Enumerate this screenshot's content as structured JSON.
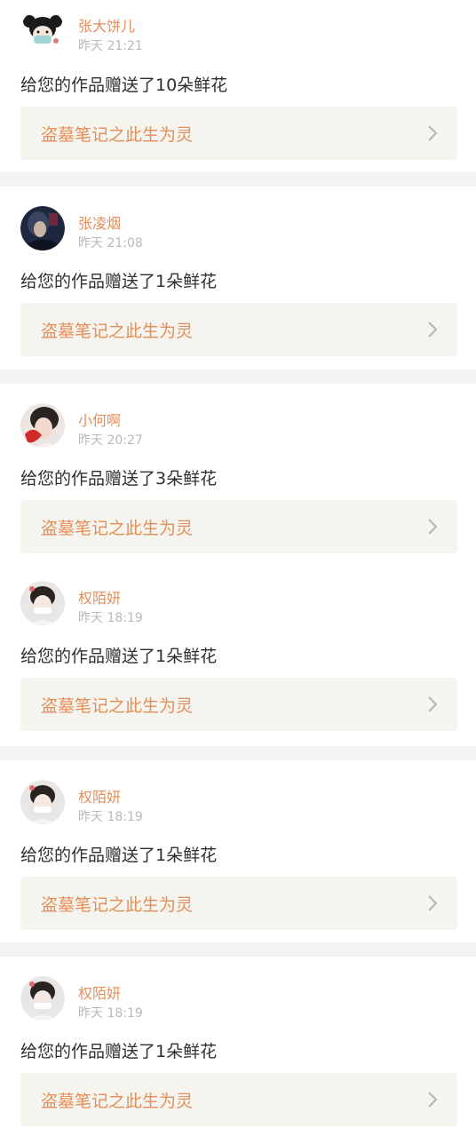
{
  "notifications": [
    {
      "name": "张大饼儿",
      "time": "昨天 21:21",
      "message": "给您的作品赠送了10朵鲜花",
      "work_title": "盗墓笔记之此生为灵",
      "avatar": "avatar-cartoon-girl-mask"
    },
    {
      "name": "张凌烟",
      "time": "昨天 21:08",
      "message": "给您的作品赠送了1朵鲜花",
      "work_title": "盗墓笔记之此生为灵",
      "avatar": "avatar-dark-photo"
    },
    {
      "name": "小何啊",
      "time": "昨天 20:27",
      "message": "给您的作品赠送了3朵鲜花",
      "work_title": "盗墓笔记之此生为灵",
      "avatar": "avatar-girl-red"
    },
    {
      "name": "权陌妍",
      "time": "昨天 18:19",
      "message": "给您的作品赠送了1朵鲜花",
      "work_title": "盗墓笔记之此生为灵",
      "avatar": "avatar-girl-white"
    },
    {
      "name": "权陌妍",
      "time": "昨天 18:19",
      "message": "给您的作品赠送了1朵鲜花",
      "work_title": "盗墓笔记之此生为灵",
      "avatar": "avatar-girl-white"
    },
    {
      "name": "权陌妍",
      "time": "昨天 18:19",
      "message": "给您的作品赠送了1朵鲜花",
      "work_title": "盗墓笔记之此生为灵",
      "avatar": "avatar-girl-white"
    }
  ],
  "colors": {
    "name": "#e58e5a",
    "time": "#b8b8b8",
    "message": "#2f2f2f",
    "work_bg": "#f5f4ee",
    "separator": "#f3f3f3"
  }
}
